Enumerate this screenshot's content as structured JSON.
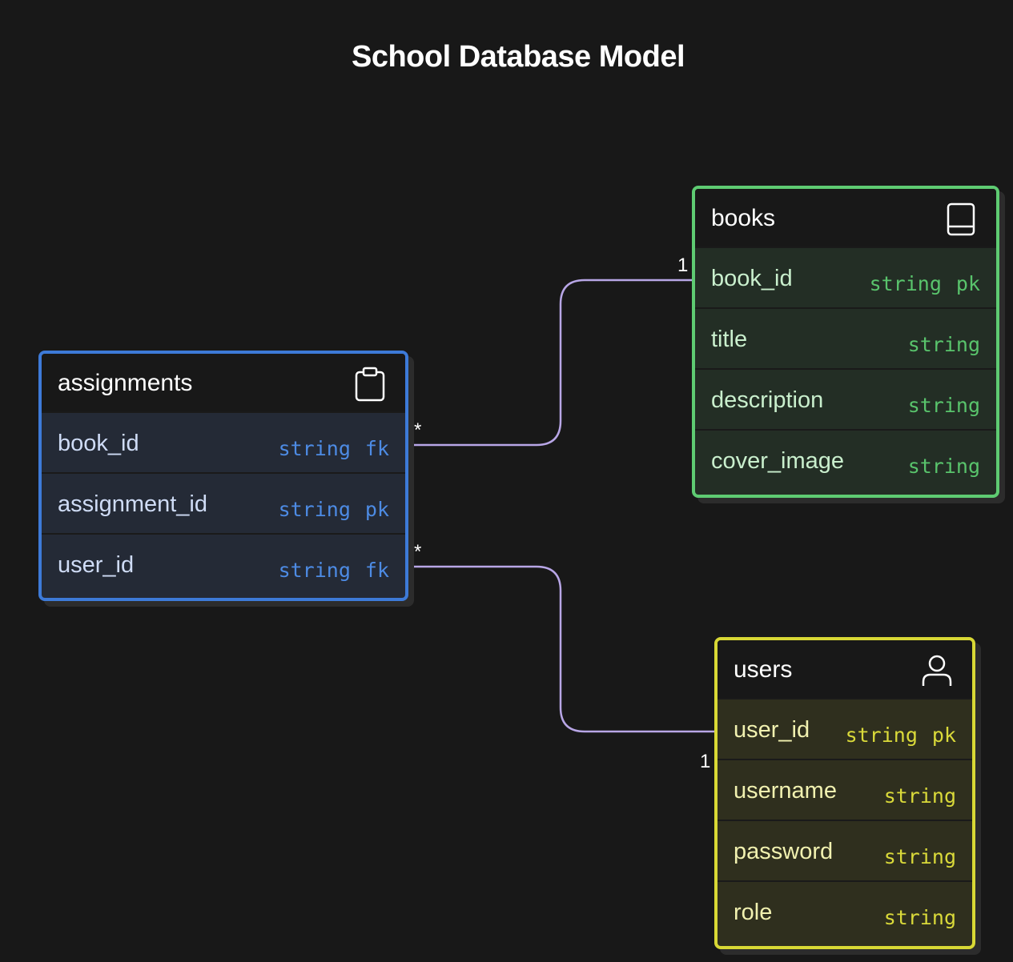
{
  "diagram": {
    "title": "School Database Model",
    "colors": {
      "background": "#181818",
      "assignments": "#3d7ad8",
      "books": "#5ecb72",
      "users": "#d8d835",
      "relationship_line": "#b8a6e6"
    },
    "entities": {
      "assignments": {
        "name": "assignments",
        "icon": "clipboard-icon",
        "fields": [
          {
            "name": "book_id",
            "type": "string",
            "key": "fk"
          },
          {
            "name": "assignment_id",
            "type": "string",
            "key": "pk"
          },
          {
            "name": "user_id",
            "type": "string",
            "key": "fk"
          }
        ]
      },
      "books": {
        "name": "books",
        "icon": "book-icon",
        "fields": [
          {
            "name": "book_id",
            "type": "string",
            "key": "pk"
          },
          {
            "name": "title",
            "type": "string",
            "key": ""
          },
          {
            "name": "description",
            "type": "string",
            "key": ""
          },
          {
            "name": "cover_image",
            "type": "string",
            "key": ""
          }
        ]
      },
      "users": {
        "name": "users",
        "icon": "user-icon",
        "fields": [
          {
            "name": "user_id",
            "type": "string",
            "key": "pk"
          },
          {
            "name": "username",
            "type": "string",
            "key": ""
          },
          {
            "name": "password",
            "type": "string",
            "key": ""
          },
          {
            "name": "role",
            "type": "string",
            "key": ""
          }
        ]
      }
    },
    "relationships": [
      {
        "from": "assignments.book_id",
        "to": "books.book_id",
        "from_cardinality": "*",
        "to_cardinality": "1"
      },
      {
        "from": "assignments.user_id",
        "to": "users.user_id",
        "from_cardinality": "*",
        "to_cardinality": "1"
      }
    ]
  }
}
